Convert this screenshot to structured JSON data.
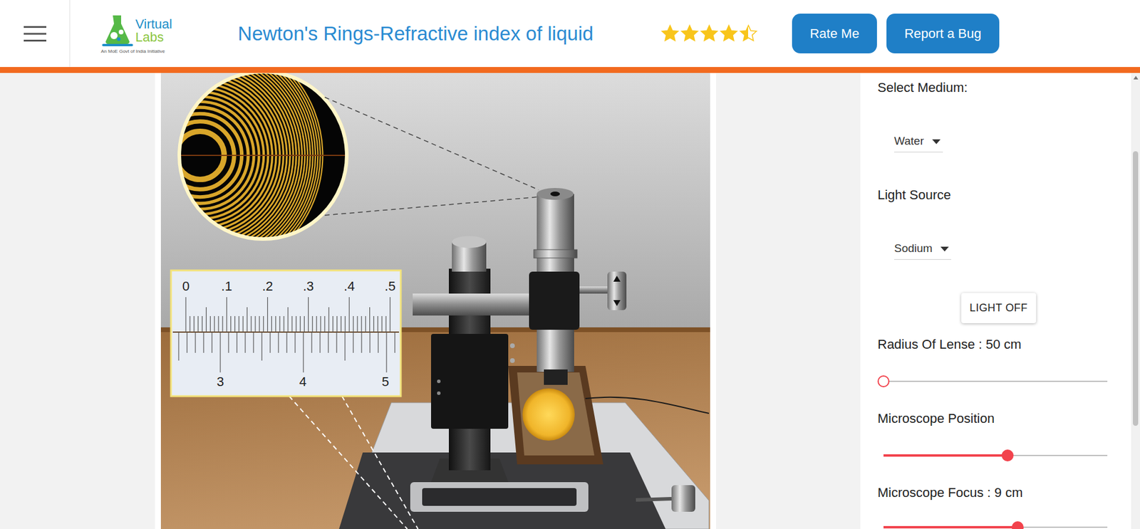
{
  "header": {
    "logo": {
      "line1": "Virtual",
      "line2": "Labs",
      "tagline": "An MoE Govt of India Initiative"
    },
    "title": "Newton's Rings-Refractive index of liquid",
    "rating": {
      "stars": 4.5
    },
    "buttons": [
      {
        "label": "Rate Me"
      },
      {
        "label": "Report a Bug"
      }
    ]
  },
  "simulation": {
    "light_on": true,
    "scale": {
      "main": [
        "0",
        ".1",
        ".2",
        ".3",
        ".4",
        ".5"
      ],
      "vernier": [
        "3",
        "4",
        "5"
      ]
    }
  },
  "controls": {
    "medium": {
      "label": "Select Medium:",
      "value": "Water"
    },
    "light_source": {
      "label": "Light Source",
      "value": "Sodium"
    },
    "light_button": "LIGHT OFF",
    "sliders": [
      {
        "label": "Radius Of Lense : 50 cm",
        "level": 0
      },
      {
        "label": "Microscope Position",
        "level": 0.555
      },
      {
        "label": "Microscope Focus : 9 cm",
        "level": 0.6
      }
    ]
  }
}
